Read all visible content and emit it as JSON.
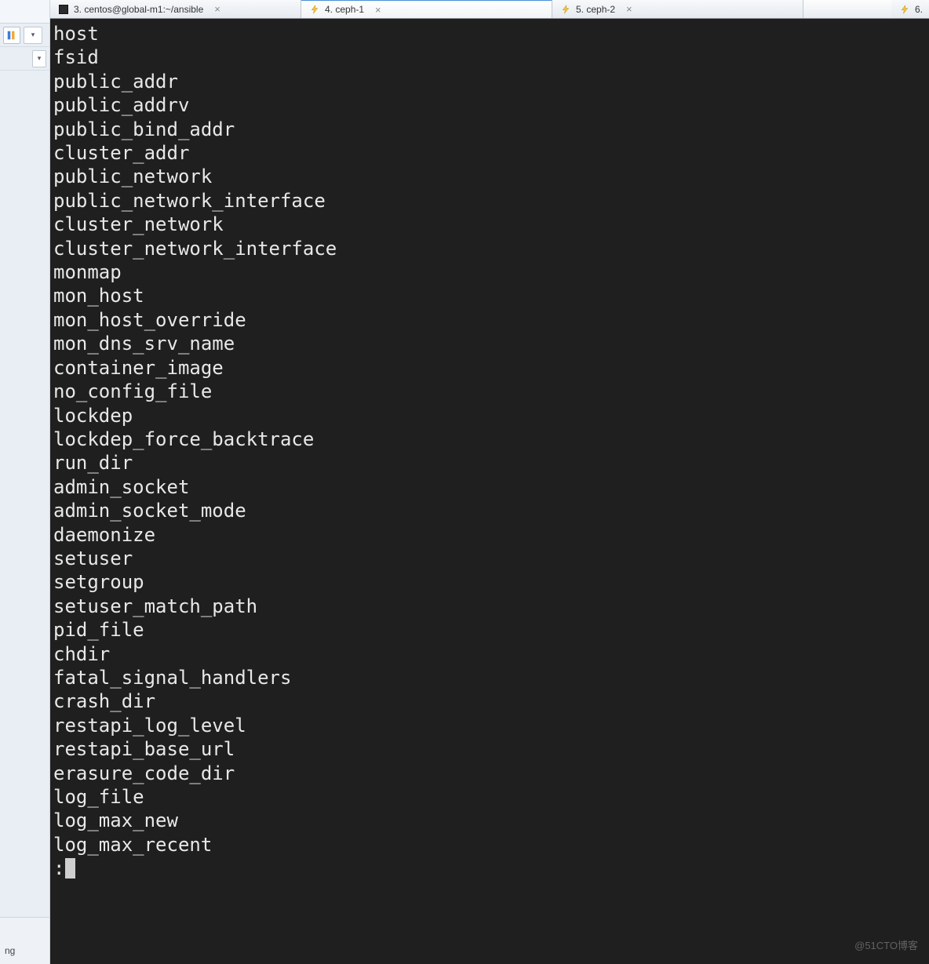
{
  "left_strip": {
    "bottom_text": "ng"
  },
  "tabs": [
    {
      "label": "3. centos@global-m1:~/ansible",
      "icon": "terminal",
      "active": false
    },
    {
      "label": "4. ceph-1",
      "icon": "bolt",
      "active": true
    },
    {
      "label": "5. ceph-2",
      "icon": "bolt",
      "active": false
    },
    {
      "label": "6.",
      "icon": "bolt",
      "active": false
    }
  ],
  "terminal": {
    "lines": [
      "host",
      "fsid",
      "public_addr",
      "public_addrv",
      "public_bind_addr",
      "cluster_addr",
      "public_network",
      "public_network_interface",
      "cluster_network",
      "cluster_network_interface",
      "monmap",
      "mon_host",
      "mon_host_override",
      "mon_dns_srv_name",
      "container_image",
      "no_config_file",
      "lockdep",
      "lockdep_force_backtrace",
      "run_dir",
      "admin_socket",
      "admin_socket_mode",
      "daemonize",
      "setuser",
      "setgroup",
      "setuser_match_path",
      "pid_file",
      "chdir",
      "fatal_signal_handlers",
      "crash_dir",
      "restapi_log_level",
      "restapi_base_url",
      "erasure_code_dir",
      "log_file",
      "log_max_new",
      "log_max_recent"
    ],
    "prompt": ":"
  },
  "watermark": "@51CTO博客"
}
